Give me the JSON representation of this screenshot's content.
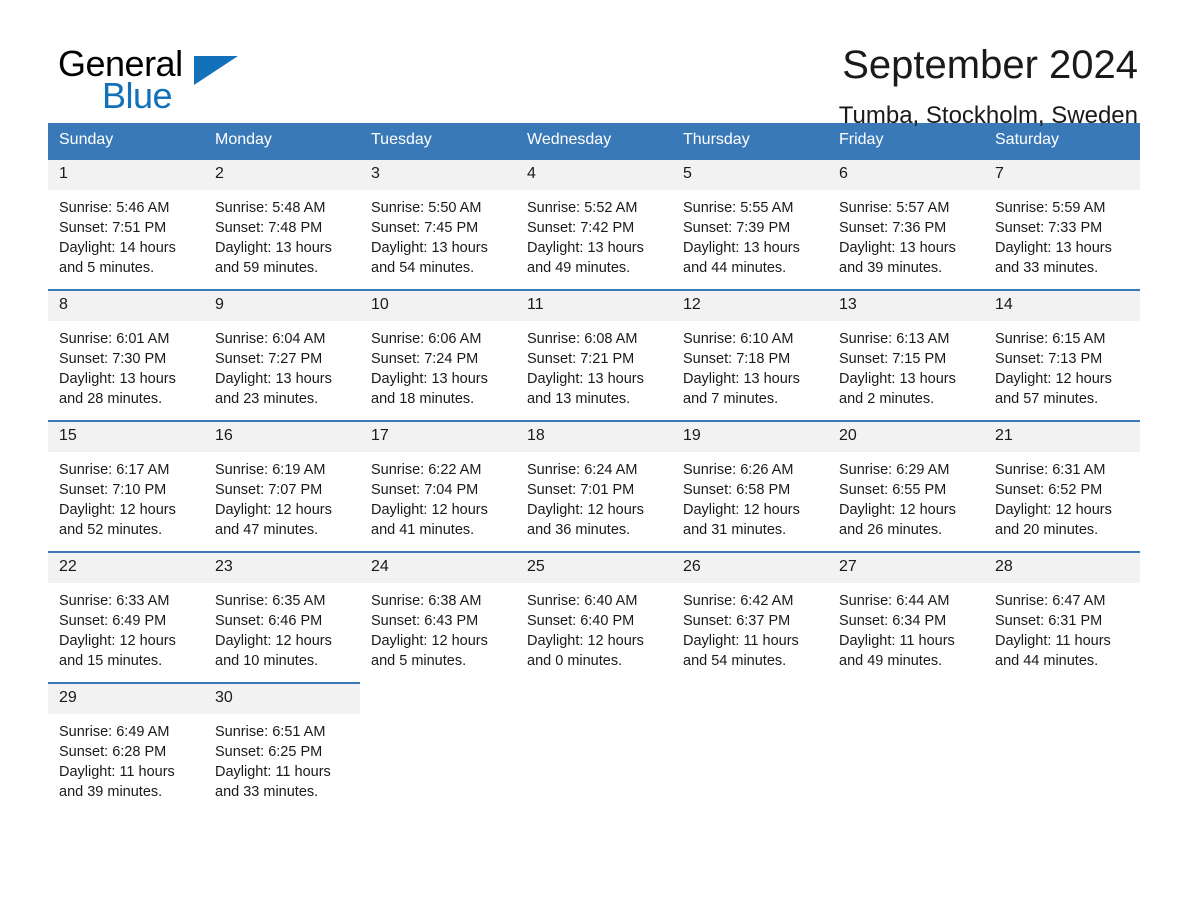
{
  "logo": {
    "word_one": "General",
    "word_two": "Blue",
    "triangle_icon": "triangle-icon",
    "brand_blue": "#1271b8"
  },
  "header": {
    "title": "September 2024",
    "subtitle": "Tumba, Stockholm, Sweden"
  },
  "theme": {
    "header_blue": "#3a79b8",
    "daynum_bg": "#f2f2f2",
    "text": "#1a1a1a"
  },
  "weekdays": [
    "Sunday",
    "Monday",
    "Tuesday",
    "Wednesday",
    "Thursday",
    "Friday",
    "Saturday"
  ],
  "weeks": [
    [
      {
        "day": "1",
        "sunrise": "Sunrise: 5:46 AM",
        "sunset": "Sunset: 7:51 PM",
        "daylight": "Daylight: 14 hours and 5 minutes."
      },
      {
        "day": "2",
        "sunrise": "Sunrise: 5:48 AM",
        "sunset": "Sunset: 7:48 PM",
        "daylight": "Daylight: 13 hours and 59 minutes."
      },
      {
        "day": "3",
        "sunrise": "Sunrise: 5:50 AM",
        "sunset": "Sunset: 7:45 PM",
        "daylight": "Daylight: 13 hours and 54 minutes."
      },
      {
        "day": "4",
        "sunrise": "Sunrise: 5:52 AM",
        "sunset": "Sunset: 7:42 PM",
        "daylight": "Daylight: 13 hours and 49 minutes."
      },
      {
        "day": "5",
        "sunrise": "Sunrise: 5:55 AM",
        "sunset": "Sunset: 7:39 PM",
        "daylight": "Daylight: 13 hours and 44 minutes."
      },
      {
        "day": "6",
        "sunrise": "Sunrise: 5:57 AM",
        "sunset": "Sunset: 7:36 PM",
        "daylight": "Daylight: 13 hours and 39 minutes."
      },
      {
        "day": "7",
        "sunrise": "Sunrise: 5:59 AM",
        "sunset": "Sunset: 7:33 PM",
        "daylight": "Daylight: 13 hours and 33 minutes."
      }
    ],
    [
      {
        "day": "8",
        "sunrise": "Sunrise: 6:01 AM",
        "sunset": "Sunset: 7:30 PM",
        "daylight": "Daylight: 13 hours and 28 minutes."
      },
      {
        "day": "9",
        "sunrise": "Sunrise: 6:04 AM",
        "sunset": "Sunset: 7:27 PM",
        "daylight": "Daylight: 13 hours and 23 minutes."
      },
      {
        "day": "10",
        "sunrise": "Sunrise: 6:06 AM",
        "sunset": "Sunset: 7:24 PM",
        "daylight": "Daylight: 13 hours and 18 minutes."
      },
      {
        "day": "11",
        "sunrise": "Sunrise: 6:08 AM",
        "sunset": "Sunset: 7:21 PM",
        "daylight": "Daylight: 13 hours and 13 minutes."
      },
      {
        "day": "12",
        "sunrise": "Sunrise: 6:10 AM",
        "sunset": "Sunset: 7:18 PM",
        "daylight": "Daylight: 13 hours and 7 minutes."
      },
      {
        "day": "13",
        "sunrise": "Sunrise: 6:13 AM",
        "sunset": "Sunset: 7:15 PM",
        "daylight": "Daylight: 13 hours and 2 minutes."
      },
      {
        "day": "14",
        "sunrise": "Sunrise: 6:15 AM",
        "sunset": "Sunset: 7:13 PM",
        "daylight": "Daylight: 12 hours and 57 minutes."
      }
    ],
    [
      {
        "day": "15",
        "sunrise": "Sunrise: 6:17 AM",
        "sunset": "Sunset: 7:10 PM",
        "daylight": "Daylight: 12 hours and 52 minutes."
      },
      {
        "day": "16",
        "sunrise": "Sunrise: 6:19 AM",
        "sunset": "Sunset: 7:07 PM",
        "daylight": "Daylight: 12 hours and 47 minutes."
      },
      {
        "day": "17",
        "sunrise": "Sunrise: 6:22 AM",
        "sunset": "Sunset: 7:04 PM",
        "daylight": "Daylight: 12 hours and 41 minutes."
      },
      {
        "day": "18",
        "sunrise": "Sunrise: 6:24 AM",
        "sunset": "Sunset: 7:01 PM",
        "daylight": "Daylight: 12 hours and 36 minutes."
      },
      {
        "day": "19",
        "sunrise": "Sunrise: 6:26 AM",
        "sunset": "Sunset: 6:58 PM",
        "daylight": "Daylight: 12 hours and 31 minutes."
      },
      {
        "day": "20",
        "sunrise": "Sunrise: 6:29 AM",
        "sunset": "Sunset: 6:55 PM",
        "daylight": "Daylight: 12 hours and 26 minutes."
      },
      {
        "day": "21",
        "sunrise": "Sunrise: 6:31 AM",
        "sunset": "Sunset: 6:52 PM",
        "daylight": "Daylight: 12 hours and 20 minutes."
      }
    ],
    [
      {
        "day": "22",
        "sunrise": "Sunrise: 6:33 AM",
        "sunset": "Sunset: 6:49 PM",
        "daylight": "Daylight: 12 hours and 15 minutes."
      },
      {
        "day": "23",
        "sunrise": "Sunrise: 6:35 AM",
        "sunset": "Sunset: 6:46 PM",
        "daylight": "Daylight: 12 hours and 10 minutes."
      },
      {
        "day": "24",
        "sunrise": "Sunrise: 6:38 AM",
        "sunset": "Sunset: 6:43 PM",
        "daylight": "Daylight: 12 hours and 5 minutes."
      },
      {
        "day": "25",
        "sunrise": "Sunrise: 6:40 AM",
        "sunset": "Sunset: 6:40 PM",
        "daylight": "Daylight: 12 hours and 0 minutes."
      },
      {
        "day": "26",
        "sunrise": "Sunrise: 6:42 AM",
        "sunset": "Sunset: 6:37 PM",
        "daylight": "Daylight: 11 hours and 54 minutes."
      },
      {
        "day": "27",
        "sunrise": "Sunrise: 6:44 AM",
        "sunset": "Sunset: 6:34 PM",
        "daylight": "Daylight: 11 hours and 49 minutes."
      },
      {
        "day": "28",
        "sunrise": "Sunrise: 6:47 AM",
        "sunset": "Sunset: 6:31 PM",
        "daylight": "Daylight: 11 hours and 44 minutes."
      }
    ],
    [
      {
        "day": "29",
        "sunrise": "Sunrise: 6:49 AM",
        "sunset": "Sunset: 6:28 PM",
        "daylight": "Daylight: 11 hours and 39 minutes."
      },
      {
        "day": "30",
        "sunrise": "Sunrise: 6:51 AM",
        "sunset": "Sunset: 6:25 PM",
        "daylight": "Daylight: 11 hours and 33 minutes."
      },
      {
        "day": "",
        "sunrise": "",
        "sunset": "",
        "daylight": ""
      },
      {
        "day": "",
        "sunrise": "",
        "sunset": "",
        "daylight": ""
      },
      {
        "day": "",
        "sunrise": "",
        "sunset": "",
        "daylight": ""
      },
      {
        "day": "",
        "sunrise": "",
        "sunset": "",
        "daylight": ""
      },
      {
        "day": "",
        "sunrise": "",
        "sunset": "",
        "daylight": ""
      }
    ]
  ]
}
